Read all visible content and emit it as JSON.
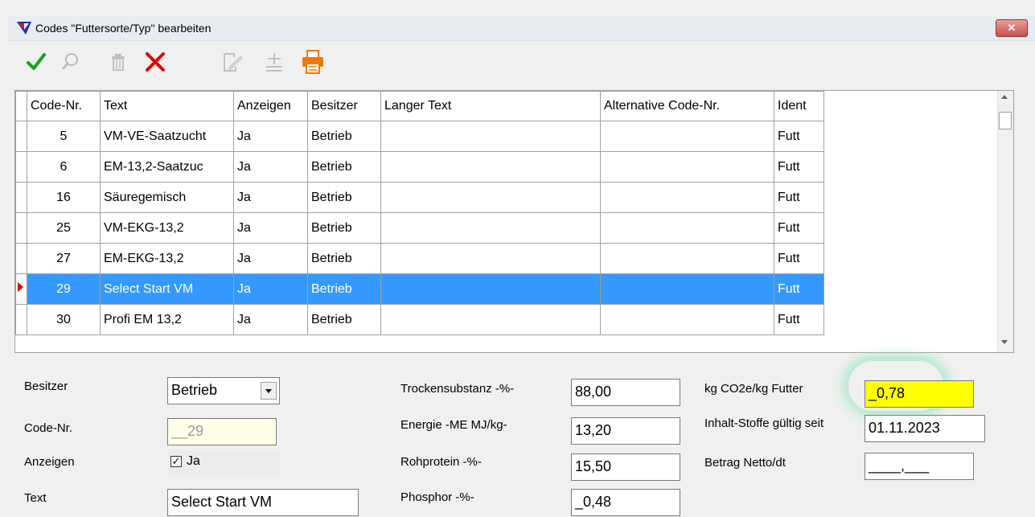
{
  "window": {
    "title": "Codes \"Futtersorte/Typ\" bearbeiten",
    "close_label": "✕"
  },
  "toolbar": {
    "items": [
      {
        "name": "confirm",
        "icon": "check-icon"
      },
      {
        "name": "search",
        "icon": "search-icon"
      },
      {
        "name": "delete",
        "icon": "trash-icon"
      },
      {
        "name": "cancel",
        "icon": "x-icon"
      },
      {
        "name": "edit",
        "icon": "edit-icon"
      },
      {
        "name": "add",
        "icon": "plus-minus-icon"
      },
      {
        "name": "print",
        "icon": "printer-icon"
      }
    ]
  },
  "grid": {
    "columns": [
      "Code-Nr.",
      "Text",
      "Anzeigen",
      "Besitzer",
      "Langer Text",
      "Alternative Code-Nr.",
      "Ident"
    ],
    "rows": [
      {
        "code": "5",
        "text": "VM-VE-Saatzucht",
        "anzeigen": "Ja",
        "besitzer": "Betrieb",
        "langer": "",
        "alt": "",
        "ident": "Futt",
        "selected": false
      },
      {
        "code": "6",
        "text": "EM-13,2-Saatzuc",
        "anzeigen": "Ja",
        "besitzer": "Betrieb",
        "langer": "",
        "alt": "",
        "ident": "Futt",
        "selected": false
      },
      {
        "code": "16",
        "text": "Säuregemisch",
        "anzeigen": "Ja",
        "besitzer": "Betrieb",
        "langer": "",
        "alt": "",
        "ident": "Futt",
        "selected": false
      },
      {
        "code": "25",
        "text": "VM-EKG-13,2",
        "anzeigen": "Ja",
        "besitzer": "Betrieb",
        "langer": "",
        "alt": "",
        "ident": "Futt",
        "selected": false
      },
      {
        "code": "27",
        "text": "EM-EKG-13,2",
        "anzeigen": "Ja",
        "besitzer": "Betrieb",
        "langer": "",
        "alt": "",
        "ident": "Futt",
        "selected": false
      },
      {
        "code": "29",
        "text": "Select Start VM",
        "anzeigen": "Ja",
        "besitzer": "Betrieb",
        "langer": "",
        "alt": "",
        "ident": "Futt",
        "selected": true
      },
      {
        "code": "30",
        "text": "Profi EM 13,2",
        "anzeigen": "Ja",
        "besitzer": "Betrieb",
        "langer": "",
        "alt": "",
        "ident": "Futt",
        "selected": false
      }
    ]
  },
  "form": {
    "besitzer_label": "Besitzer",
    "besitzer_value": "Betrieb",
    "code_label": "Code-Nr.",
    "code_value": "__29",
    "anzeigen_label": "Anzeigen",
    "anzeigen_check": "✓",
    "anzeigen_value": "Ja",
    "text_label": "Text",
    "text_value": "Select Start VM",
    "trocken_label": "Trockensubstanz -%-",
    "trocken_value": "88,00",
    "energie_label": "Energie -ME MJ/kg-",
    "energie_value": "13,20",
    "rohprotein_label": "Rohprotein -%-",
    "rohprotein_value": "15,50",
    "phosphor_label": "Phosphor -%-",
    "phosphor_value": "_0,48",
    "co2_label": "kg CO2e/kg Futter",
    "co2_value": "_0,78",
    "inhalt_label": "Inhalt-Stoffe gültig seit",
    "inhalt_value": "01.11.2023",
    "betrag_label": "Betrag Netto/dt",
    "betrag_value": "____,___"
  },
  "colors": {
    "selection": "#3399ff",
    "highlight_field": "#ffff00",
    "check_green": "#1aa01a",
    "cancel_red": "#e00000",
    "printer_orange": "#f07800"
  }
}
